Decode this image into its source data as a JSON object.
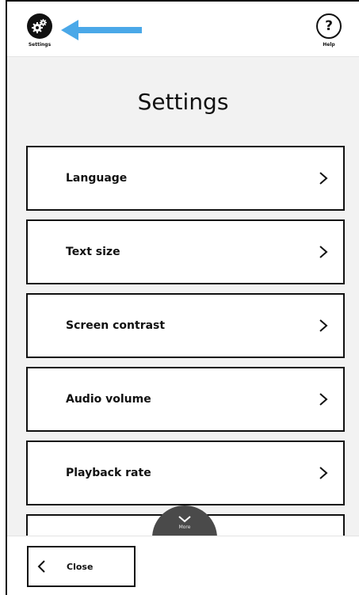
{
  "header": {
    "settings_label": "Settings",
    "settings_icon": "gears-icon",
    "help_label": "Help",
    "help_symbol": "?",
    "pointer_arrow_color": "#4aa8e8"
  },
  "main": {
    "title": "Settings",
    "items": [
      {
        "label": "Language"
      },
      {
        "label": "Text size"
      },
      {
        "label": "Screen contrast"
      },
      {
        "label": "Audio volume"
      },
      {
        "label": "Playback rate"
      }
    ]
  },
  "more": {
    "label": "More",
    "color": "#4a4a4a"
  },
  "footer": {
    "close_label": "Close"
  }
}
